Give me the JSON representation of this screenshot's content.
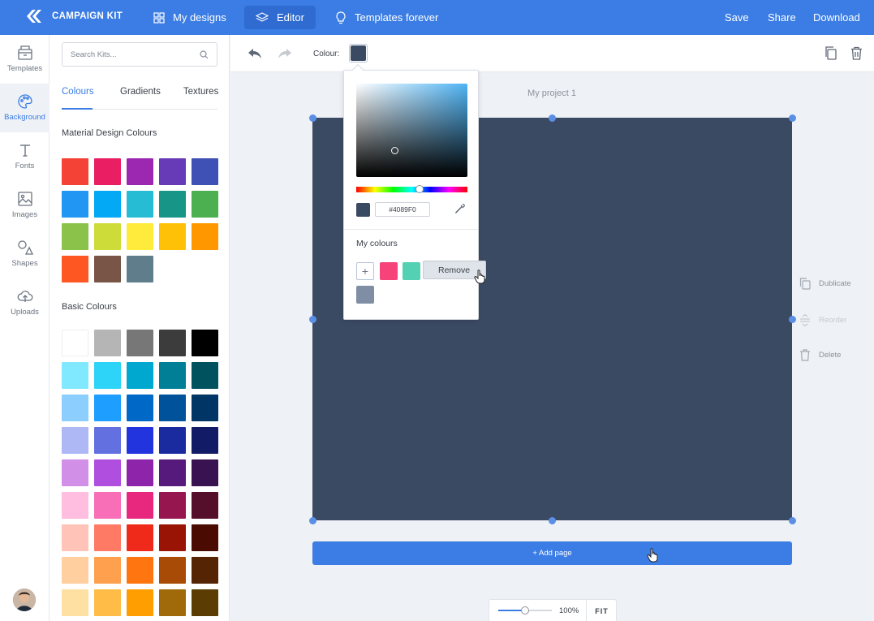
{
  "app": {
    "name": "CAMPAIGN KIT"
  },
  "topnav": {
    "my_designs": "My designs",
    "editor": "Editor",
    "templates_forever": "Templates forever",
    "save": "Save",
    "share": "Share",
    "download": "Download"
  },
  "rail": {
    "templates": "Templates",
    "background": "Background",
    "fonts": "Fonts",
    "images": "Images",
    "shapes": "Shapes",
    "uploads": "Uploads"
  },
  "panel": {
    "search_placeholder": "Search Kits...",
    "tabs": [
      "Colours",
      "Gradients",
      "Textures"
    ],
    "material_title": "Material Design Colours",
    "material_colours": [
      "#f44336",
      "#e91e63",
      "#9c27b0",
      "#673ab7",
      "#3f51b5",
      "#2196f3",
      "#03a9f4",
      "#26bcd4",
      "#179688",
      "#4caf50",
      "#8bc34a",
      "#cddc39",
      "#ffeb3b",
      "#ffc107",
      "#ff9800",
      "#ff5722",
      "#795548",
      "#607d8b"
    ],
    "basic_title": "Basic Colours",
    "basic_colours": [
      "#ffffff",
      "#b5b5b5",
      "#777777",
      "#3c3c3c",
      "#000000",
      "#80e9ff",
      "#2dd4f7",
      "#00a8cf",
      "#007f97",
      "#00525f",
      "#8ccfff",
      "#1e9eff",
      "#0068c7",
      "#00539a",
      "#003566",
      "#adb8f5",
      "#6270e0",
      "#2134de",
      "#1a2ba0",
      "#121c66",
      "#d18fe8",
      "#b04ee0",
      "#8e24aa",
      "#561a7c",
      "#391251",
      "#ffbde0",
      "#f86fb7",
      "#e8287f",
      "#96174f",
      "#560f2a",
      "#ffc3b8",
      "#ff7a65",
      "#ef2a1a",
      "#9a1405",
      "#4a0b03",
      "#ffcfa0",
      "#ffa04f",
      "#ff7610",
      "#a84b07",
      "#542404",
      "#ffe0a3",
      "#ffbd48",
      "#ff9e00",
      "#a06a0a",
      "#5b3c03"
    ]
  },
  "toolbar": {
    "colour_label": "Colour:",
    "colour_value": "#3b4a63"
  },
  "canvas": {
    "project_title": "My project 1",
    "background": "#3b4a63",
    "add_page": "+ Add page"
  },
  "side_actions": {
    "duplicate": "Dublicate",
    "reorder": "Reorder",
    "delete": "Delete"
  },
  "zoom": {
    "value": "100%",
    "fit": "FIT",
    "level": 0.5
  },
  "picker": {
    "hex": "#4089F0",
    "current_colour": "#3b4a63",
    "hue_colour": "#4fb4f5",
    "hue_position": 0.57,
    "saturation": 0.35,
    "brightness": 0.28,
    "my_colours_title": "My colours",
    "my_colours": [
      "#f6447a",
      "#53d1b2",
      "#7f8ea4"
    ],
    "remove": "Remove"
  }
}
